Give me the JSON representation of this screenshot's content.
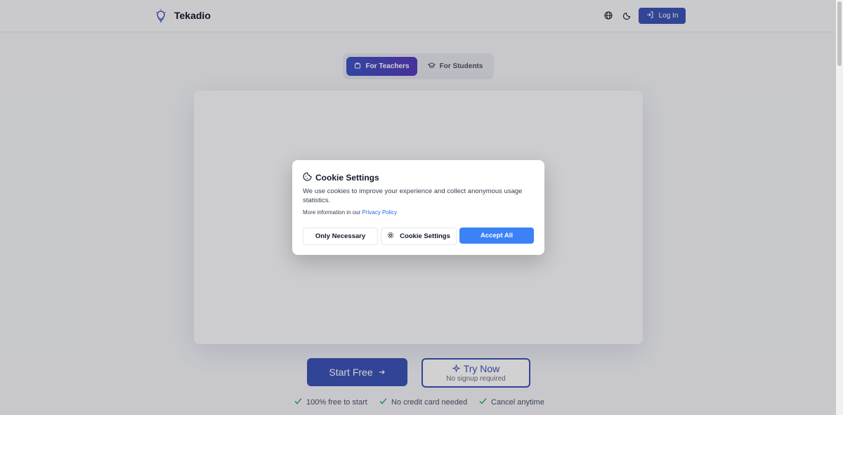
{
  "header": {
    "brand": "Tekadio",
    "login_label": "Log In"
  },
  "tabs": [
    {
      "label": "For Teachers",
      "active": true
    },
    {
      "label": "For Students",
      "active": false
    }
  ],
  "cta": {
    "start_label": "Start Free",
    "try_label": "Try Now",
    "try_sub": "No signup required"
  },
  "benefits": [
    "100% free to start",
    "No credit card needed",
    "Cancel anytime"
  ],
  "cookie_modal": {
    "title": "Cookie Settings",
    "text": "We use cookies to improve your experience and collect anonymous usage statistics.",
    "more_prefix": "More information in our",
    "privacy_link": "Privacy Policy",
    "buttons": {
      "necessary": "Only Necessary",
      "settings": "Cookie Settings",
      "accept": "Accept All"
    }
  },
  "colors": {
    "primary": "#3e53b7",
    "accept": "#3b82f6",
    "link": "#2563eb"
  },
  "icons": [
    "lightbulb-icon",
    "globe-icon",
    "moon-icon",
    "login-icon",
    "teacher-icon",
    "graduation-cap-icon",
    "arrow-right-icon",
    "sparkle-icon",
    "check-icon",
    "cookie-icon",
    "gear-icon"
  ]
}
